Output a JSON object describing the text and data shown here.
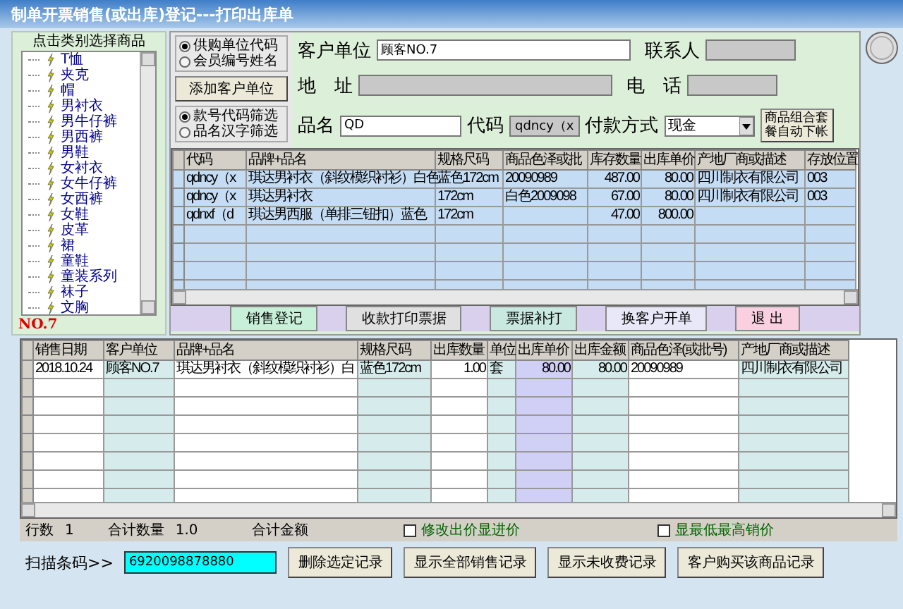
{
  "window": {
    "title": "制单开票销售(或出库)登记---打印出库单"
  },
  "category_panel": {
    "title": "点击类别选择商品",
    "current": "NO.7",
    "items": [
      {
        "label": "T恤"
      },
      {
        "label": "夹克"
      },
      {
        "label": "帽"
      },
      {
        "label": "男衬衣"
      },
      {
        "label": "男牛仔裤"
      },
      {
        "label": "男西裤"
      },
      {
        "label": "男鞋"
      },
      {
        "label": "女衬衣"
      },
      {
        "label": "女牛仔裤"
      },
      {
        "label": "女西裤"
      },
      {
        "label": "女鞋"
      },
      {
        "label": "皮革"
      },
      {
        "label": "裙"
      },
      {
        "label": "童鞋"
      },
      {
        "label": "童装系列"
      },
      {
        "label": "袜子"
      },
      {
        "label": "文胸"
      }
    ]
  },
  "customer_source": [
    {
      "label": "供购单位代码",
      "selected": true
    },
    {
      "label": "会员编号姓名",
      "selected": false
    }
  ],
  "add_customer_button": "添加客户单位",
  "filter_mode": [
    {
      "label": "款号代码筛选",
      "selected": true
    },
    {
      "label": "品名汉字筛选",
      "selected": false
    }
  ],
  "form": {
    "customer_label": "客户单位",
    "customer_value": "顾客NO.7",
    "contact_label": "联系人",
    "address_label": "地　址",
    "phone_label": "电　话",
    "name_label": "品名",
    "name_value": "QD",
    "code_label": "代码",
    "code_value": "qdncy（x",
    "payment_label": "付款方式",
    "payment_value": "现金"
  },
  "combo_button": "商品组合套餐自动下帐",
  "product_table": {
    "columns": [
      "代码",
      "品牌+品名",
      "规格尺码",
      "商品色泽或批",
      "库存数量",
      "出库单价",
      "产地厂商或描述",
      "存放位置"
    ],
    "rows": [
      [
        "qdncy（x",
        "琪达男衬衣（斜纹模织衬衫）白色",
        "蓝色172cm",
        "20090989",
        "487.00",
        "80.00",
        "四川制衣有限公司",
        "003"
      ],
      [
        "qdncy（x",
        "琪达男衬衣",
        "172cm",
        "白色2009098",
        "67.00",
        "80.00",
        "四川制衣有限公司",
        "003"
      ],
      [
        "qdnxf（d",
        "琪达男西服（单排三钮扣）蓝色",
        "172cm",
        "",
        "47.00",
        "800.00",
        "",
        ""
      ]
    ]
  },
  "actions": [
    "销售登记",
    "收款打印票据",
    "票据补打",
    "换客户开单",
    "退 出"
  ],
  "sales_table": {
    "columns": [
      "销售日期",
      "客户单位",
      "品牌+品名",
      "规格尺码",
      "出库数量",
      "单位",
      "出库单价",
      "出库金额",
      "商品色泽(或批号)",
      "产地厂商或描述"
    ],
    "rows": [
      [
        "2018.10.24",
        "顾客NO.7",
        "琪达男衬衣（斜纹模织衬衫）白",
        "蓝色172cm",
        "1.00",
        "套",
        "80.00",
        "80.00",
        "20090989",
        "四川制衣有限公司"
      ]
    ]
  },
  "totals": {
    "rows_label": "行数",
    "rows_value": "1",
    "qty_label": "合计数量",
    "qty_value": "1.0",
    "amount_label": "合计金额"
  },
  "options": [
    {
      "label": "修改出价显进价",
      "checked": false
    },
    {
      "label": "显最低最高销价",
      "checked": false
    }
  ],
  "barcode": {
    "label": "扫描条码>>",
    "value": "6920098878880"
  },
  "bottom_buttons": [
    "删除选定记录",
    "显示全部销售记录",
    "显示未收费记录",
    "客户购买该商品记录"
  ]
}
